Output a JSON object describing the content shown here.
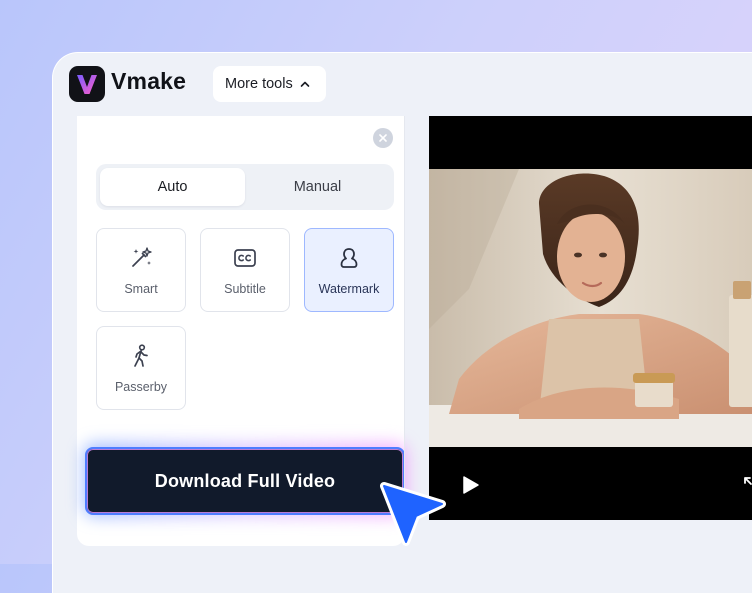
{
  "app": {
    "brand_name": "Vmake",
    "logo_icon": "vmake-v-logo-icon",
    "more_tools_label": "More tools",
    "more_tools_icon": "chevron-up-icon"
  },
  "panel": {
    "close_icon": "close-icon",
    "mode_tabs": [
      {
        "label": "Auto",
        "selected": true
      },
      {
        "label": "Manual",
        "selected": false
      }
    ],
    "tools": [
      {
        "label": "Smart",
        "icon": "magic-wand-sparkle-icon",
        "selected": false
      },
      {
        "label": "Subtitle",
        "icon": "closed-caption-icon",
        "selected": false
      },
      {
        "label": "Watermark",
        "icon": "watermark-person-icon",
        "selected": true
      },
      {
        "label": "Passerby",
        "icon": "walking-person-icon",
        "selected": false
      }
    ],
    "download_label": "Download Full Video"
  },
  "video": {
    "play_icon": "play-icon",
    "fullscreen_icon": "expand-icon",
    "pointer_icon": "pointer-cursor-icon"
  },
  "colors": {
    "accent_blue": "#4f7dff",
    "download_bg": "#111a2b",
    "selected_tile_bg": "#eaf0ff",
    "logo_gradient_start": "#7a5cff",
    "logo_gradient_end": "#ff5fc8"
  }
}
